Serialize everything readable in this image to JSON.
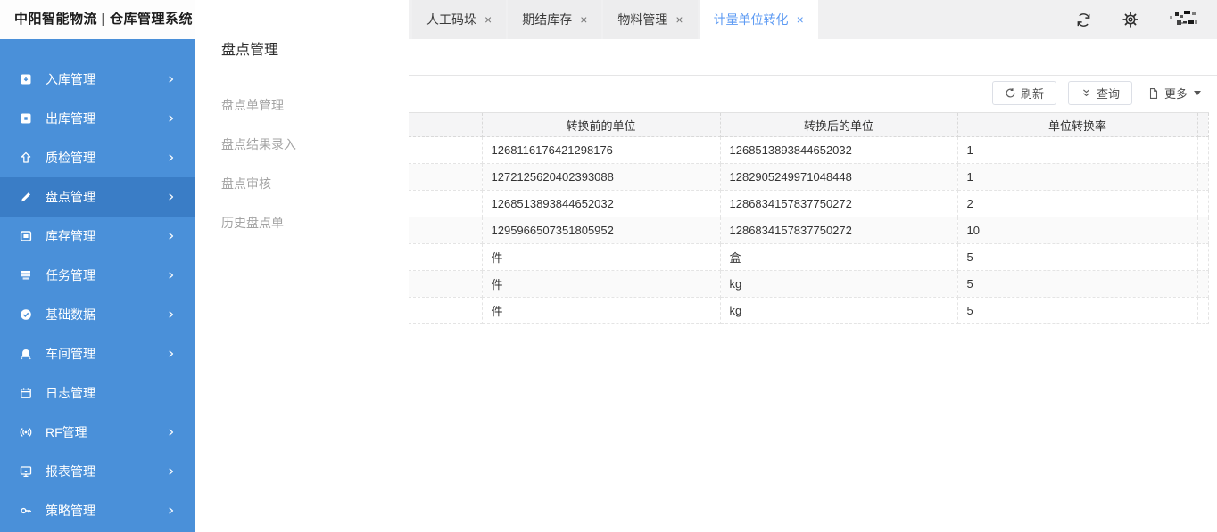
{
  "app": {
    "title": "中阳智能物流 | 仓库管理系统"
  },
  "sidebar": {
    "items": [
      {
        "label": "入库管理"
      },
      {
        "label": "出库管理"
      },
      {
        "label": "质检管理"
      },
      {
        "label": "盘点管理"
      },
      {
        "label": "库存管理"
      },
      {
        "label": "任务管理"
      },
      {
        "label": "基础数据"
      },
      {
        "label": "车间管理"
      },
      {
        "label": "日志管理"
      },
      {
        "label": "RF管理"
      },
      {
        "label": "报表管理"
      },
      {
        "label": "策略管理"
      }
    ]
  },
  "submenu": {
    "title": "盘点管理",
    "items": [
      {
        "label": "盘点单管理"
      },
      {
        "label": "盘点结果录入"
      },
      {
        "label": "盘点审核"
      },
      {
        "label": "历史盘点单"
      }
    ]
  },
  "tabs": [
    {
      "label": "人工码垛"
    },
    {
      "label": "期结库存"
    },
    {
      "label": "物料管理"
    },
    {
      "label": "计量单位转化"
    }
  ],
  "toolbar": {
    "refresh_label": "刷新",
    "query_label": "查询",
    "more_label": "更多"
  },
  "table": {
    "columns": [
      "转换前的单位",
      "转换后的单位",
      "单位转换率"
    ],
    "rows": [
      [
        "1268116176421298176",
        "1268513893844652032",
        "1"
      ],
      [
        "1272125620402393088",
        "1282905249971048448",
        "1"
      ],
      [
        "1268513893844652032",
        "1286834157837750272",
        "2"
      ],
      [
        "1295966507351805952",
        "1286834157837750272",
        "10"
      ],
      [
        "件",
        "盒",
        "5"
      ],
      [
        "件",
        "kg",
        "5"
      ],
      [
        "件",
        "kg",
        "5"
      ]
    ]
  },
  "ui": {
    "close": "×"
  },
  "colors": {
    "sidebar_blue": "#4a90d9",
    "sidebar_active_blue": "#3a7dc6",
    "active_tab_text": "#5e9bf3",
    "tabbar_bg": "#f0f0f1",
    "table_header_bg": "#f5f5f6",
    "stripe_row_bg": "#fafafa"
  }
}
